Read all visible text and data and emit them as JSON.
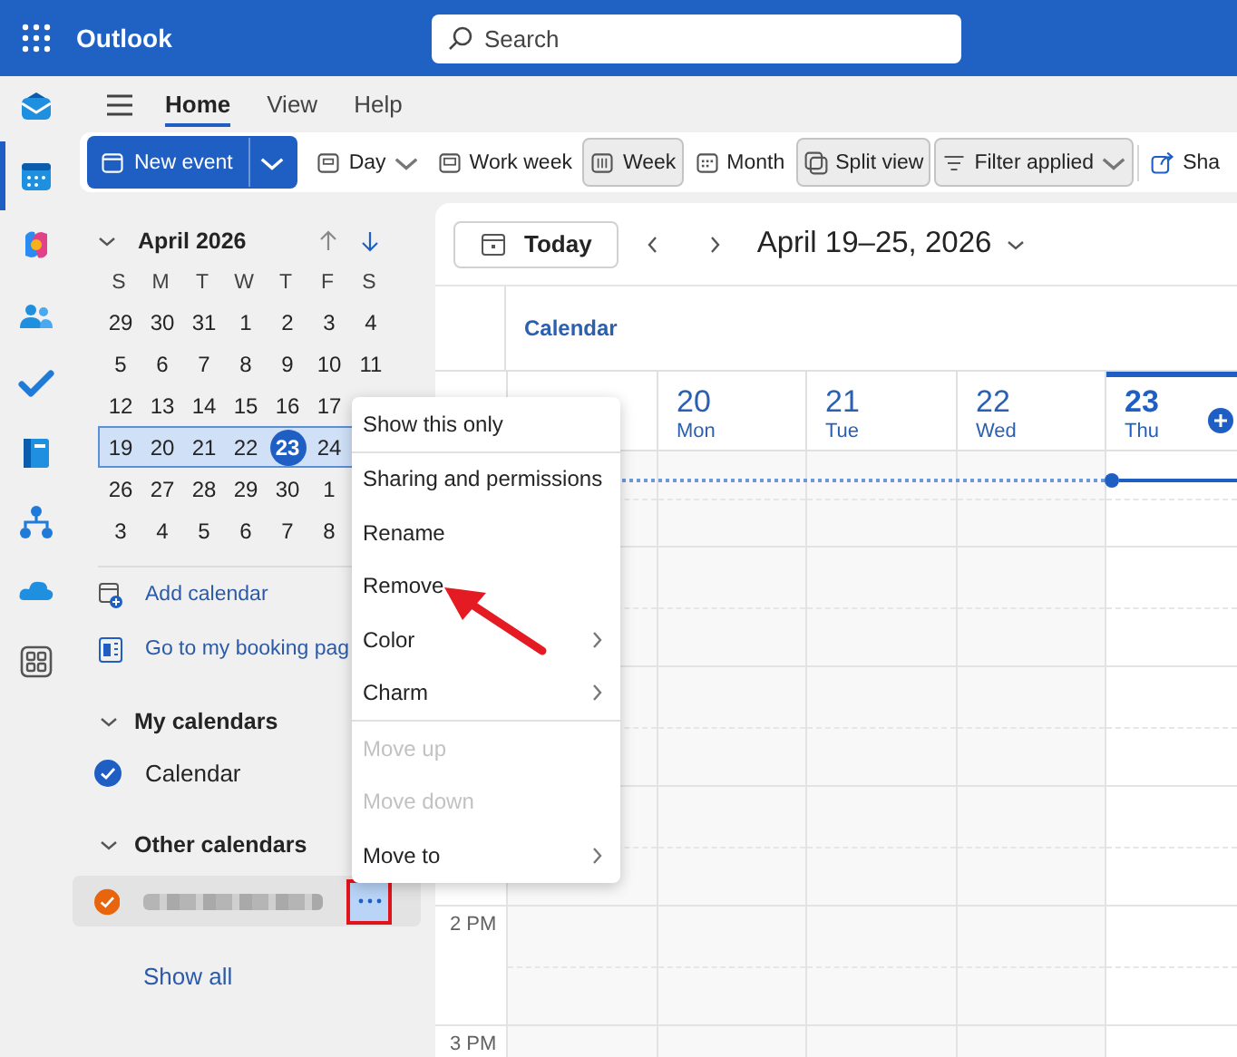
{
  "app": {
    "name": "Outlook"
  },
  "search": {
    "placeholder": "Search"
  },
  "rail": [
    {
      "selected": false
    },
    {
      "selected": true
    },
    {
      "selected": false
    },
    {
      "selected": false
    },
    {
      "selected": false
    },
    {
      "selected": false
    },
    {
      "selected": false
    },
    {
      "selected": false
    },
    {
      "selected": false
    }
  ],
  "ribbon_tabs": [
    {
      "label": "Home",
      "selected": true
    },
    {
      "label": "View",
      "selected": false
    },
    {
      "label": "Help",
      "selected": false
    }
  ],
  "toolbar": [
    {
      "label": "New event",
      "kind": "split",
      "selected": false
    },
    {
      "label": "Day",
      "kind": "dropdown",
      "selected": false
    },
    {
      "label": "Work week",
      "kind": "view",
      "selected": false
    },
    {
      "label": "Week",
      "kind": "view",
      "selected": true
    },
    {
      "label": "Month",
      "kind": "view",
      "selected": false
    },
    {
      "label": "Split view",
      "kind": "view",
      "selected": true
    },
    {
      "label": "Filter applied",
      "kind": "dropdown",
      "selected": true
    },
    {
      "label": "Sha",
      "kind": "share",
      "selected": false
    }
  ],
  "mini_calendar": {
    "title": "April 2026",
    "weekdays": [
      "S",
      "M",
      "T",
      "W",
      "T",
      "F",
      "S"
    ],
    "weeks": [
      {
        "selected": false,
        "days": [
          {
            "day": "29",
            "today": false
          },
          {
            "day": "30",
            "today": false
          },
          {
            "day": "31",
            "today": false
          },
          {
            "day": "1",
            "today": false
          },
          {
            "day": "2",
            "today": false
          },
          {
            "day": "3",
            "today": false
          },
          {
            "day": "4",
            "today": false
          }
        ]
      },
      {
        "selected": false,
        "days": [
          {
            "day": "5",
            "today": false
          },
          {
            "day": "6",
            "today": false
          },
          {
            "day": "7",
            "today": false
          },
          {
            "day": "8",
            "today": false
          },
          {
            "day": "9",
            "today": false
          },
          {
            "day": "10",
            "today": false
          },
          {
            "day": "11",
            "today": false
          }
        ]
      },
      {
        "selected": false,
        "days": [
          {
            "day": "12",
            "today": false
          },
          {
            "day": "13",
            "today": false
          },
          {
            "day": "14",
            "today": false
          },
          {
            "day": "15",
            "today": false
          },
          {
            "day": "16",
            "today": false
          },
          {
            "day": "17",
            "today": false
          }
        ]
      },
      {
        "selected": true,
        "days": [
          {
            "day": "19",
            "today": false
          },
          {
            "day": "20",
            "today": false
          },
          {
            "day": "21",
            "today": false
          },
          {
            "day": "22",
            "today": false
          },
          {
            "day": "23",
            "today": true
          },
          {
            "day": "24",
            "today": false
          }
        ]
      },
      {
        "selected": false,
        "days": [
          {
            "day": "26",
            "today": false
          },
          {
            "day": "27",
            "today": false
          },
          {
            "day": "28",
            "today": false
          },
          {
            "day": "29",
            "today": false
          },
          {
            "day": "30",
            "today": false
          },
          {
            "day": "1",
            "today": false
          }
        ]
      },
      {
        "selected": false,
        "days": [
          {
            "day": "3",
            "today": false
          },
          {
            "day": "4",
            "today": false
          },
          {
            "day": "5",
            "today": false
          },
          {
            "day": "6",
            "today": false
          },
          {
            "day": "7",
            "today": false
          },
          {
            "day": "8",
            "today": false
          }
        ]
      }
    ]
  },
  "links": [
    {
      "label": "Add calendar"
    },
    {
      "label": "Go to my booking pag"
    }
  ],
  "groups": [
    {
      "title": "My calendars",
      "expanded": true,
      "calendars": [
        {
          "name": "Calendar",
          "redacted": false,
          "color": "#1f5fc4",
          "checked": true,
          "selected": false
        }
      ]
    },
    {
      "title": "Other calendars",
      "expanded": true,
      "calendars": [
        {
          "redacted": true,
          "color": "#e8650d",
          "checked": true,
          "selected": true
        }
      ]
    }
  ],
  "show_all": "Show all",
  "calendar_view": {
    "today_button": "Today",
    "range": "April 19–25, 2026",
    "calendar_label": "Calendar",
    "days": [
      {
        "today": false
      },
      {
        "date": "20",
        "weekday": "Mon",
        "today": false
      },
      {
        "date": "21",
        "weekday": "Tue",
        "today": false
      },
      {
        "date": "22",
        "weekday": "Wed",
        "today": false
      },
      {
        "date": "23",
        "weekday": "Thu",
        "today": true
      }
    ],
    "time_slots": [
      "2 PM",
      "3 PM"
    ]
  },
  "context_menu": {
    "sections": [
      [
        {
          "label": "Show this only",
          "disabled": false,
          "submenu": false
        }
      ],
      [
        {
          "label": "Sharing and permissions",
          "disabled": false,
          "submenu": false
        },
        {
          "label": "Rename",
          "disabled": false,
          "submenu": false
        },
        {
          "label": "Remove",
          "disabled": false,
          "submenu": false
        },
        {
          "label": "Color",
          "disabled": false,
          "submenu": true
        },
        {
          "label": "Charm",
          "disabled": false,
          "submenu": true
        }
      ],
      [
        {
          "label": "Move up",
          "disabled": true,
          "submenu": false
        },
        {
          "label": "Move down",
          "disabled": true,
          "submenu": false
        },
        {
          "label": "Move to",
          "disabled": false,
          "submenu": true
        }
      ]
    ]
  }
}
